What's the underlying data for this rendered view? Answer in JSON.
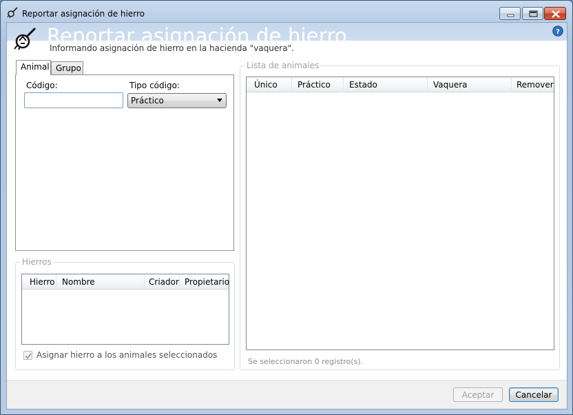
{
  "window": {
    "title": "Reportar asignación de hierro"
  },
  "header": {
    "title": "Reportar asignación de hierro",
    "subtitle": "Informando asignación de hierro en la hacienda \"vaquera\"."
  },
  "tabs": [
    {
      "label": "Animal"
    },
    {
      "label": "Grupo"
    }
  ],
  "animal_tab": {
    "codigo_label": "Código:",
    "codigo_value": "",
    "tipo_label": "Tipo código:",
    "tipo_value": "Práctico"
  },
  "hierros": {
    "legend": "Hierros",
    "columns": [
      "Hierro",
      "Nombre",
      "Criador",
      "Propietario"
    ],
    "checkbox_label": "Asignar hierro a los animales seleccionados",
    "checkbox_checked": true
  },
  "lista": {
    "legend": "Lista de animales",
    "columns": [
      "Único",
      "Práctico",
      "Estado",
      "Vaquera",
      "Remover"
    ],
    "status": "Se seleccionaron 0 registro(s)."
  },
  "footer": {
    "accept_label": "Aceptar",
    "cancel_label": "Cancelar"
  }
}
